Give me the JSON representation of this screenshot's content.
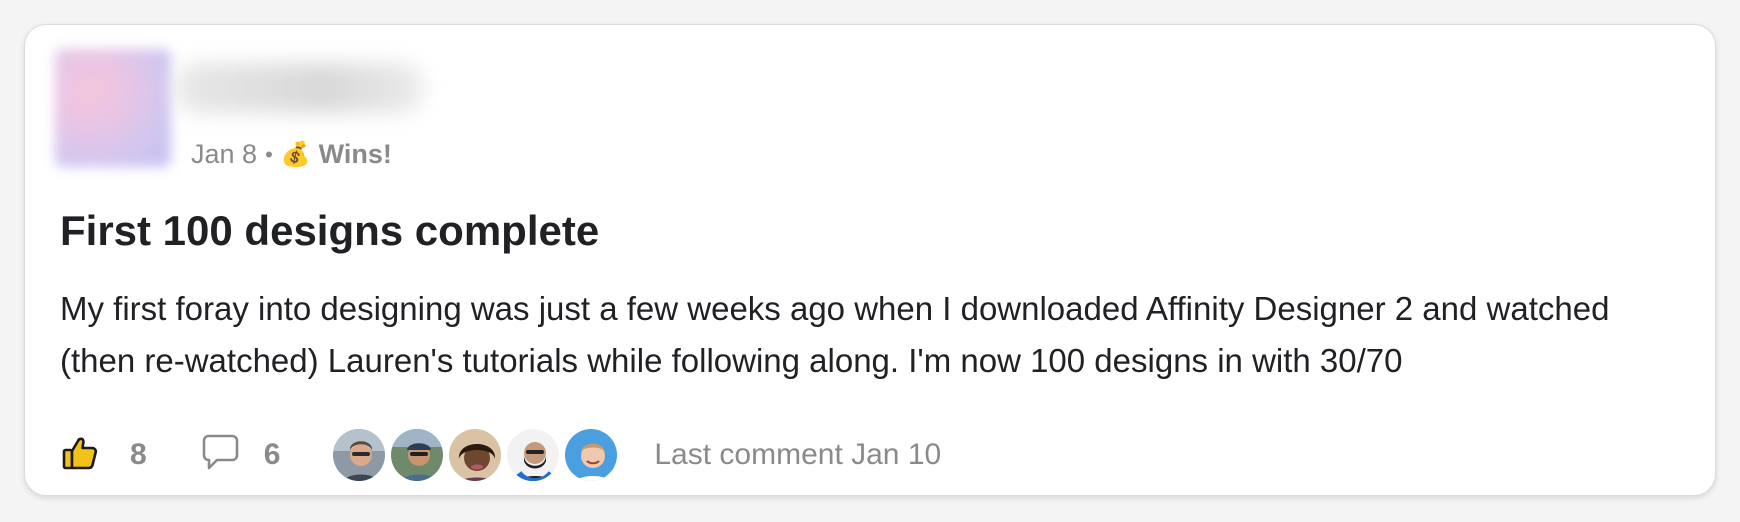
{
  "post": {
    "date": "Jan 8",
    "separator": "•",
    "category_emoji": "💰",
    "category": "Wins!",
    "title": "First 100 designs complete",
    "body": "My first foray into designing was just a few weeks ago when I downloaded Affinity Designer 2 and watched (then re-watched) Lauren's tutorials while following along. I'm now 100 designs in with 30/70"
  },
  "footer": {
    "likes": "8",
    "comments": "6",
    "last_comment": "Last comment Jan 10",
    "commenter_avatars": [
      "commenter-1",
      "commenter-2",
      "commenter-3",
      "commenter-4",
      "commenter-5"
    ]
  },
  "colors": {
    "like_icon_fill": "#f2c21a",
    "muted_text": "#8a8a8a",
    "primary_text": "#202124"
  }
}
